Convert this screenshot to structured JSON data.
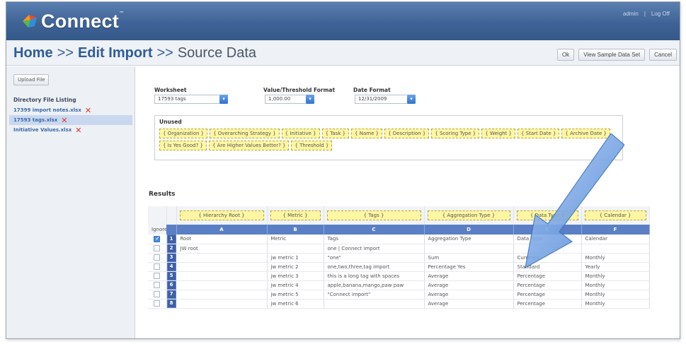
{
  "header": {
    "logo_text": "Connect",
    "logo_tm": "™",
    "admin_link": "admin",
    "divider": "|",
    "logoff_link": "Log Off"
  },
  "titlebar": {
    "crumb_home": "Home",
    "sep1": ">>",
    "crumb_edit": "Edit Import",
    "sep2": ">>",
    "current": "Source Data",
    "ok_button": "Ok",
    "sample_button": "View Sample Data Set",
    "cancel_button": "Cancel"
  },
  "sidebar": {
    "upload_button": "Upload File",
    "listing_title": "Directory File Listing",
    "files": [
      {
        "name": "17399 import notes.xlsx",
        "selected": false
      },
      {
        "name": "17593 tags.xlsx",
        "selected": true
      },
      {
        "name": "Initiative Values.xlsx",
        "selected": false
      }
    ],
    "delete_glyph": "✕"
  },
  "form": {
    "worksheet_label": "Worksheet",
    "worksheet_value": "17593 tags",
    "value_format_label": "Value/Threshold Format",
    "value_format_value": "1,000.00",
    "date_format_label": "Date Format",
    "date_format_value": "12/31/2009"
  },
  "unused": {
    "title": "Unused",
    "chips": [
      "{ Organization }",
      "{ Overarching Strategy }",
      "{ Initiative }",
      "{ Task }",
      "{ Name }",
      "{ Description }",
      "{ Scoring Type }",
      "{ Weight }",
      "{ Start Date }",
      "{ Archive Date }",
      "{ Is Yes Good? }",
      "{ Are Higher Values Better? }",
      "{ Threshold }"
    ]
  },
  "results": {
    "title": "Results",
    "ignore_label": "Ignore",
    "mappings": [
      "{ Hierarchy Root }",
      "{ Metric }",
      "{ Tags }",
      "{ Aggregation Type }",
      "{ Data Type }",
      "{ Calendar }"
    ],
    "columns": [
      "A",
      "B",
      "C",
      "D",
      "E",
      "F"
    ],
    "rows": [
      {
        "num": "1",
        "ignored": true,
        "cells": [
          "Root",
          "Metric",
          "Tags",
          "Aggregation Type",
          "Data Type",
          "Calendar"
        ]
      },
      {
        "num": "2",
        "ignored": false,
        "cells": [
          "JW root",
          "",
          "one | Connect import",
          "",
          "",
          ""
        ]
      },
      {
        "num": "3",
        "ignored": false,
        "cells": [
          "",
          "jw metric 1",
          "\"one\"",
          "Sum",
          "Currency",
          "Monthly"
        ]
      },
      {
        "num": "4",
        "ignored": false,
        "cells": [
          "",
          "jw metric 2",
          "one,two,three,tag import",
          "Percentage Yes",
          "Standard",
          "Yearly"
        ]
      },
      {
        "num": "5",
        "ignored": false,
        "cells": [
          "",
          "jw metric 3",
          "this is a long tag with spaces",
          "Average",
          "Percentage",
          "Monthly"
        ]
      },
      {
        "num": "6",
        "ignored": false,
        "cells": [
          "",
          "jw metric 4",
          "apple,banana,mango,paw paw",
          "Average",
          "Percentage",
          "Monthly"
        ]
      },
      {
        "num": "7",
        "ignored": false,
        "cells": [
          "",
          "jw metric 5",
          "\"Connect import\"",
          "Average",
          "Percentage",
          "Monthly"
        ]
      },
      {
        "num": "8",
        "ignored": false,
        "cells": [
          "",
          "jw metric 6",
          "",
          "Average",
          "Percentage",
          "Monthly"
        ]
      }
    ]
  },
  "colors": {
    "header_blue": "#3f6396",
    "column_blue": "#5a7fc4",
    "chip_yellow": "#fef6a3",
    "arrow_blue": "#6fa0e6",
    "delete_red": "#d33333"
  }
}
